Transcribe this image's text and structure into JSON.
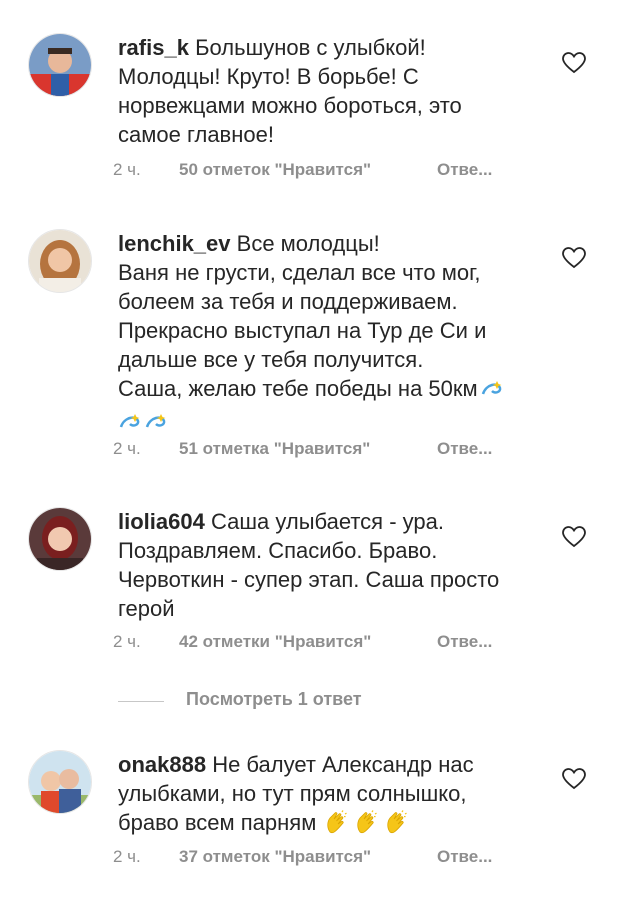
{
  "comments": [
    {
      "username": "rafis_k",
      "text_lines": [
        "Большунов с улыбкой!",
        "Молодцы! Круто! В борьбе! С",
        "норвежцами можно бороться, это",
        "самое главное!"
      ],
      "time": "2 ч.",
      "likes": "50 отметок \"Нравится\"",
      "reply": "Отве..."
    },
    {
      "username": "lenchik_ev",
      "text_lines": [
        "Все молодцы!",
        "Ваня не грусти, сделал все что мог,",
        "болеем за тебя и поддерживаем.",
        "Прекрасно выступал на Тур де Си и",
        "дальше все у тебя получится.",
        "Саша, желаю тебе победы на 50км"
      ],
      "emoji": "dizzy-emoji",
      "time": "2 ч.",
      "likes": "51 отметка \"Нравится\"",
      "reply": "Отве..."
    },
    {
      "username": "liolia604",
      "text_lines": [
        "Саша улыбается - ура.",
        "Поздравляем. Спасибо. Браво.",
        "Червоткин - супер этап. Саша просто",
        "герой"
      ],
      "time": "2 ч.",
      "likes": "42 отметки \"Нравится\"",
      "reply": "Отве..."
    },
    {
      "username": "onak888",
      "text_lines": [
        "Не балует Александр нас",
        "улыбками, но тут прям солнышко,",
        "браво всем парням"
      ],
      "emoji": "clapping-hands-emoji",
      "time": "2 ч.",
      "likes": "37 отметок \"Нравится\"",
      "reply": "Отве..."
    }
  ],
  "view_replies": "Посмотреть 1 ответ",
  "icons": {
    "like": "heart-outline-icon"
  },
  "colors": {
    "text": "#262626",
    "muted": "#8e8e8e",
    "divider": "#c7c7c7",
    "emoji_yellow": "#f5c518",
    "emoji_blue": "#4aa3df"
  }
}
